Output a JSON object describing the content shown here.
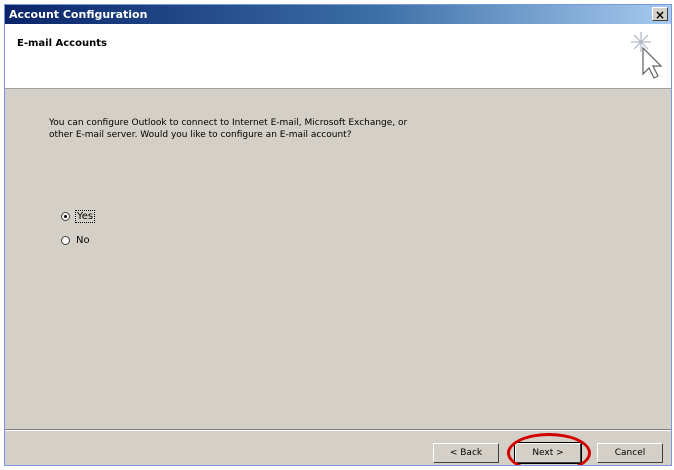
{
  "window": {
    "title": "Account Configuration",
    "close_symbol": "×"
  },
  "header": {
    "title": "E-mail Accounts",
    "icon": "wizard-sparkle-cursor-icon"
  },
  "body": {
    "prompt_line1": "You can configure Outlook to connect to Internet E-mail, Microsoft Exchange, or",
    "prompt_line2": "other E-mail server.  Would you like to configure an E-mail account?"
  },
  "options": [
    {
      "label": "Yes",
      "selected": true
    },
    {
      "label": "No",
      "selected": false
    }
  ],
  "buttons": {
    "back": "< Back",
    "next": "Next >",
    "cancel": "Cancel"
  },
  "colors": {
    "dialog_bg": "#d4d0c8",
    "highlight": "#d40000"
  }
}
